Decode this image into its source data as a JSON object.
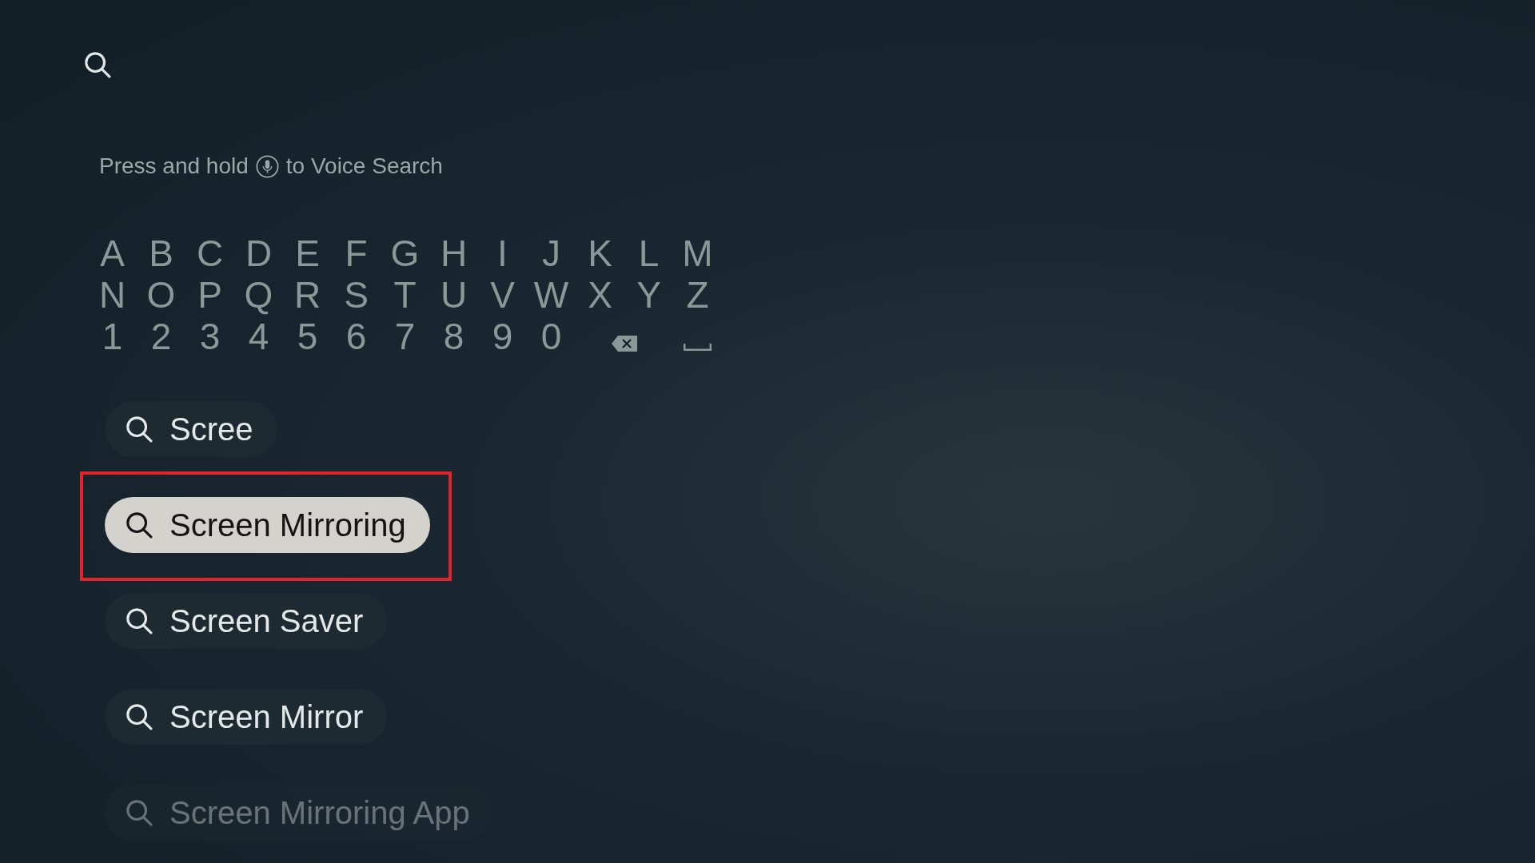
{
  "voice_hint": {
    "before": "Press and hold",
    "after": "to Voice Search"
  },
  "keyboard": {
    "rows": [
      [
        {
          "kind": "char",
          "label": "A"
        },
        {
          "kind": "char",
          "label": "B"
        },
        {
          "kind": "char",
          "label": "C"
        },
        {
          "kind": "char",
          "label": "D"
        },
        {
          "kind": "char",
          "label": "E"
        },
        {
          "kind": "char",
          "label": "F"
        },
        {
          "kind": "char",
          "label": "G"
        },
        {
          "kind": "char",
          "label": "H"
        },
        {
          "kind": "char",
          "label": "I"
        },
        {
          "kind": "char",
          "label": "J"
        },
        {
          "kind": "char",
          "label": "K"
        },
        {
          "kind": "char",
          "label": "L"
        },
        {
          "kind": "char",
          "label": "M"
        }
      ],
      [
        {
          "kind": "char",
          "label": "N"
        },
        {
          "kind": "char",
          "label": "O"
        },
        {
          "kind": "char",
          "label": "P"
        },
        {
          "kind": "char",
          "label": "Q"
        },
        {
          "kind": "char",
          "label": "R"
        },
        {
          "kind": "char",
          "label": "S"
        },
        {
          "kind": "char",
          "label": "T"
        },
        {
          "kind": "char",
          "label": "U"
        },
        {
          "kind": "char",
          "label": "V"
        },
        {
          "kind": "char",
          "label": "W"
        },
        {
          "kind": "char",
          "label": "X"
        },
        {
          "kind": "char",
          "label": "Y"
        },
        {
          "kind": "char",
          "label": "Z"
        }
      ],
      [
        {
          "kind": "char",
          "label": "1"
        },
        {
          "kind": "char",
          "label": "2"
        },
        {
          "kind": "char",
          "label": "3"
        },
        {
          "kind": "char",
          "label": "4"
        },
        {
          "kind": "char",
          "label": "5"
        },
        {
          "kind": "char",
          "label": "6"
        },
        {
          "kind": "char",
          "label": "7"
        },
        {
          "kind": "char",
          "label": "8"
        },
        {
          "kind": "char",
          "label": "9"
        },
        {
          "kind": "char",
          "label": "0"
        },
        {
          "kind": "backspace"
        },
        {
          "kind": "space"
        }
      ]
    ]
  },
  "suggestions": [
    {
      "label": "Scree",
      "selected": false,
      "annotated": false,
      "dimmed": false
    },
    {
      "label": "Screen Mirroring",
      "selected": true,
      "annotated": true,
      "dimmed": false
    },
    {
      "label": "Screen Saver",
      "selected": false,
      "annotated": false,
      "dimmed": false
    },
    {
      "label": "Screen Mirror",
      "selected": false,
      "annotated": false,
      "dimmed": false
    },
    {
      "label": "Screen Mirroring App",
      "selected": false,
      "annotated": false,
      "dimmed": true
    }
  ]
}
